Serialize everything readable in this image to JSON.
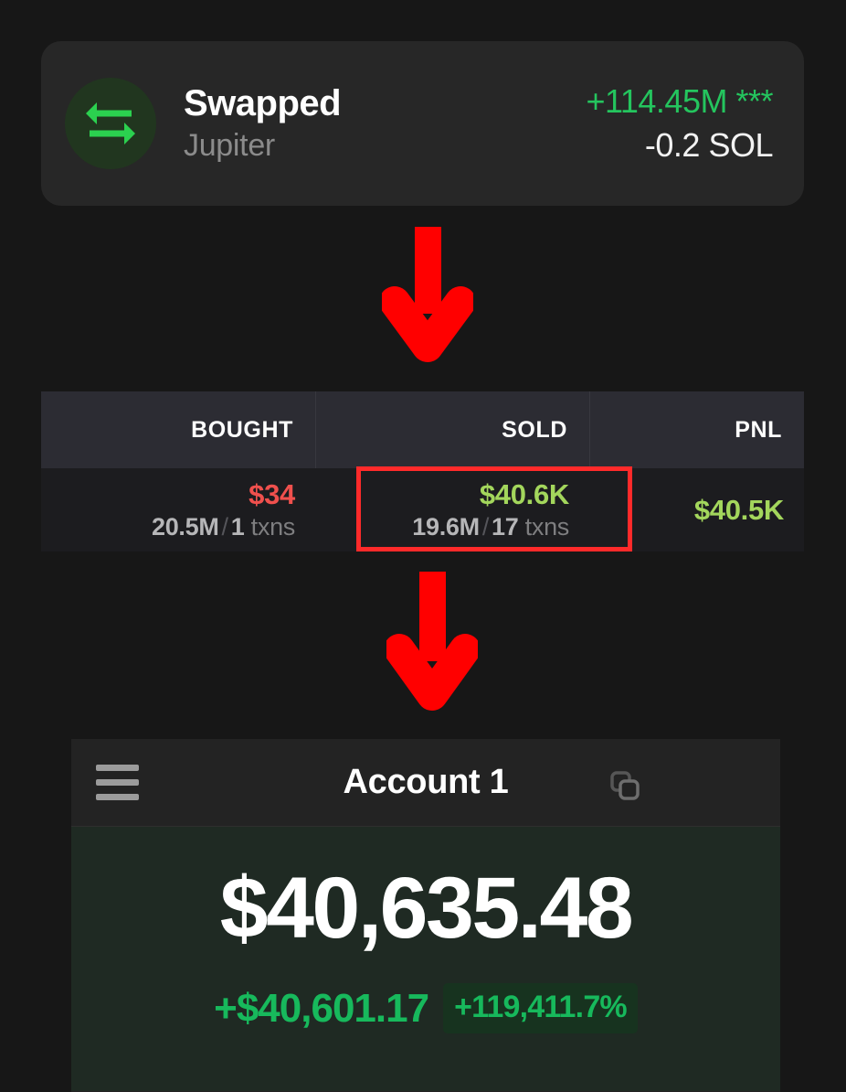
{
  "colors": {
    "page_bg": "#171717",
    "card_bg": "#272727",
    "accent_green": "#24c55e",
    "accent_bright_green": "#17b95c",
    "badge_bg": "#17331f",
    "value_green": "#a3d65c",
    "value_red": "#f0504d",
    "highlight_red": "#ff2a2a",
    "arrow_red": "#ff0000",
    "balance_panel_bg": "#1f2a23"
  },
  "swap_card": {
    "icon": "swap-arrows-icon",
    "title": "Swapped",
    "subtitle": "Jupiter",
    "amount_in": "+114.45M ***",
    "amount_out": "-0.2 SOL"
  },
  "arrows": [
    {
      "name": "flow-arrow-top",
      "direction": "down"
    },
    {
      "name": "flow-arrow-bottom",
      "direction": "down"
    }
  ],
  "stats_table": {
    "headers": [
      "BOUGHT",
      "SOLD",
      "PNL"
    ],
    "bought": {
      "amount": "$34",
      "tokens": "20.5M",
      "separator": "/",
      "txns_count": "1",
      "txns_label": "txns"
    },
    "sold": {
      "amount": "$40.6K",
      "tokens": "19.6M",
      "separator": "/",
      "txns_count": "17",
      "txns_label": "txns",
      "highlighted": true
    },
    "pnl": {
      "amount": "$40.5K"
    }
  },
  "wallet": {
    "menu_icon": "hamburger-menu-icon",
    "account_name": "Account 1",
    "copy_icon": "copy-icon",
    "balance": "$40,635.48",
    "change_amount": "+$40,601.17",
    "change_percent": "+119,411.7%"
  }
}
